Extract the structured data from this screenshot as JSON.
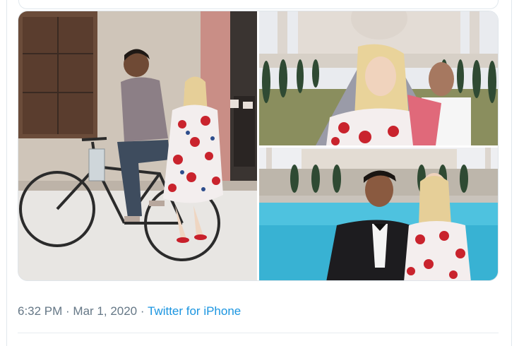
{
  "tweet": {
    "time": "6:32 PM",
    "separator": " · ",
    "date": "Mar 1, 2020",
    "source": "Twitter for iPhone"
  },
  "media": [
    {
      "name": "photo-bicycle-edit"
    },
    {
      "name": "photo-taj-mahal-edit-1"
    },
    {
      "name": "photo-taj-mahal-edit-2"
    }
  ],
  "colors": {
    "link": "#1b95e0",
    "meta_text": "#657786",
    "border": "#e1e8ed"
  }
}
